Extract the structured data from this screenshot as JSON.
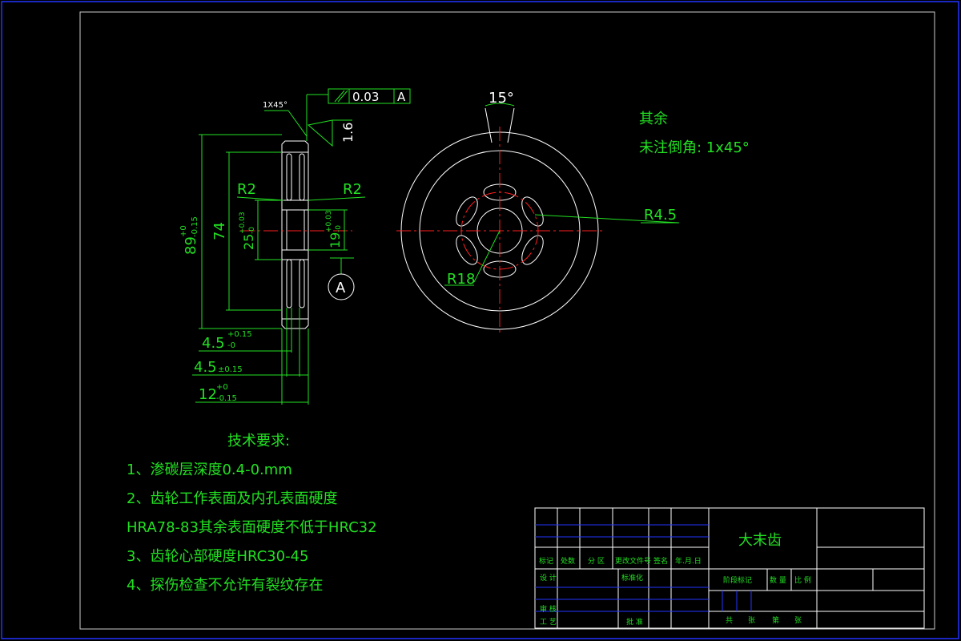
{
  "colors": {
    "background": "#000000",
    "outline": "#ffffff",
    "dimension": "#22e022",
    "centerline": "#ff2020",
    "frame": "#2233ff"
  },
  "side_view": {
    "chamfer_label": "1X45°",
    "tolerance_frame": {
      "value": "0.03",
      "datum": "A"
    },
    "roughness": "1.6",
    "radius_left": "R2",
    "radius_right": "R2",
    "dim_89": {
      "main": "89",
      "upper": "+0",
      "lower": "-0.15"
    },
    "dim_74": "74",
    "dim_25": {
      "main": "25",
      "upper": "+0.03",
      "lower": "-0"
    },
    "dim_19": {
      "main": "19",
      "upper": "+0.03",
      "lower": "-0"
    },
    "datum_label": "A",
    "dim_4_5a": {
      "main": "4.5",
      "upper": "+0.15",
      "lower": "-0"
    },
    "dim_4_5b": {
      "main": "4.5",
      "tol": "±0.15"
    },
    "dim_12": {
      "main": "12",
      "upper": "+0",
      "lower": "-0.15"
    }
  },
  "front_view": {
    "angle": "15°",
    "radius_hole": "R4.5",
    "radius_pcd": "R18"
  },
  "notes": {
    "line1": "其余",
    "line2": "未注倒角: 1x45°"
  },
  "tech_requirements": {
    "title": "技术要求:",
    "items": [
      "1、渗碳层深度0.4-0.mm",
      "2、齿轮工作表面及内孔表面硬度",
      "HRA78-83其余表面硬度不低于HRC32",
      "3、齿轮心部硬度HRC30-45",
      "4、探伤检查不允许有裂纹存在"
    ]
  },
  "title_block": {
    "part_name": "大末齿",
    "labels": {
      "mark": "标记",
      "count": "处数",
      "zone": "分 区",
      "change_doc": "更改文件号",
      "sign": "签名",
      "date": "年.月.日",
      "design": "设 计",
      "standardize": "标准化",
      "check": "审 核",
      "process": "工 艺",
      "approve": "批 准",
      "stage_mark": "阶段标记",
      "weight": "数 量",
      "scale": "比 例",
      "total": "共",
      "sheets": "张",
      "page": "第",
      "sheet2": "张"
    }
  }
}
